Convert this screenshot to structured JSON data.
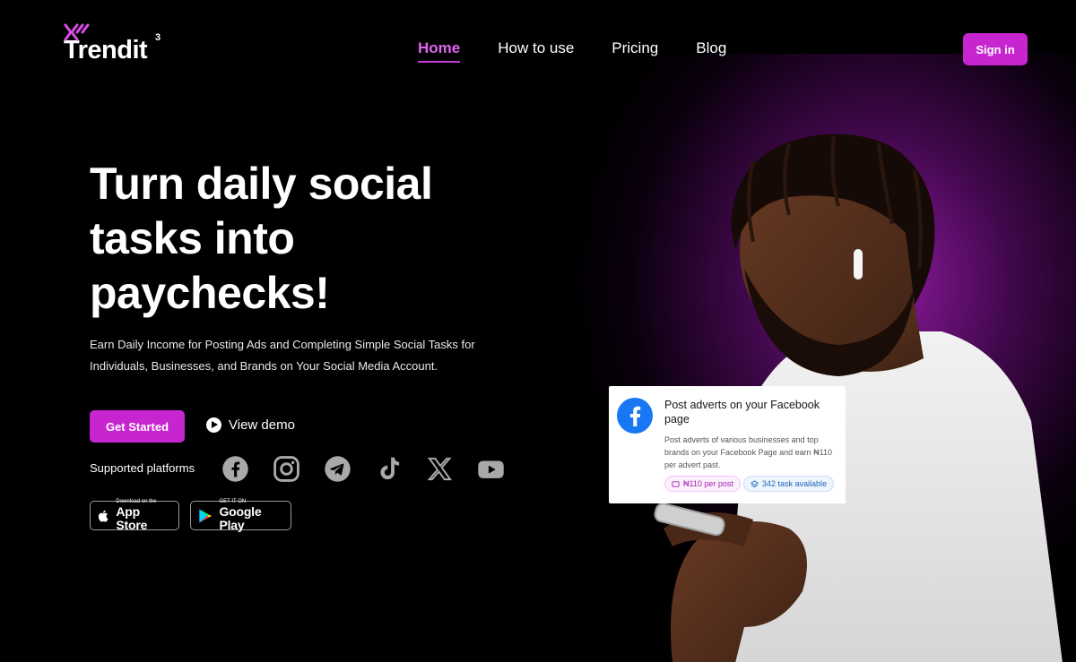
{
  "brand": {
    "name": "Trendit",
    "superscript": "3",
    "accent": "#c725cf"
  },
  "nav": {
    "items": [
      {
        "label": "Home",
        "active": true
      },
      {
        "label": "How to use",
        "active": false
      },
      {
        "label": "Pricing",
        "active": false
      },
      {
        "label": "Blog",
        "active": false
      }
    ],
    "sign_in": "Sign in"
  },
  "hero": {
    "title": "Turn daily social tasks into paychecks!",
    "description": "Earn Daily Income for Posting Ads and Completing Simple Social Tasks for Individuals, Businesses, and Brands on Your Social Media Account.",
    "get_started": "Get Started",
    "view_demo": "View demo",
    "platforms_label": "Supported platforms",
    "platforms": [
      "facebook-icon",
      "instagram-icon",
      "telegram-icon",
      "tiktok-icon",
      "x-icon",
      "youtube-icon"
    ]
  },
  "stores": {
    "apple": {
      "small": "Download on the",
      "big": "App Store"
    },
    "google": {
      "small": "GET IT ON",
      "big": "Google Play"
    }
  },
  "task_card": {
    "title": "Post adverts on your Facebook page",
    "description": "Post adverts of various businesses and top brands on your Facebook Page and earn ₦110 per advert past.",
    "price": "₦110 per post",
    "tasks": "342 task available"
  }
}
